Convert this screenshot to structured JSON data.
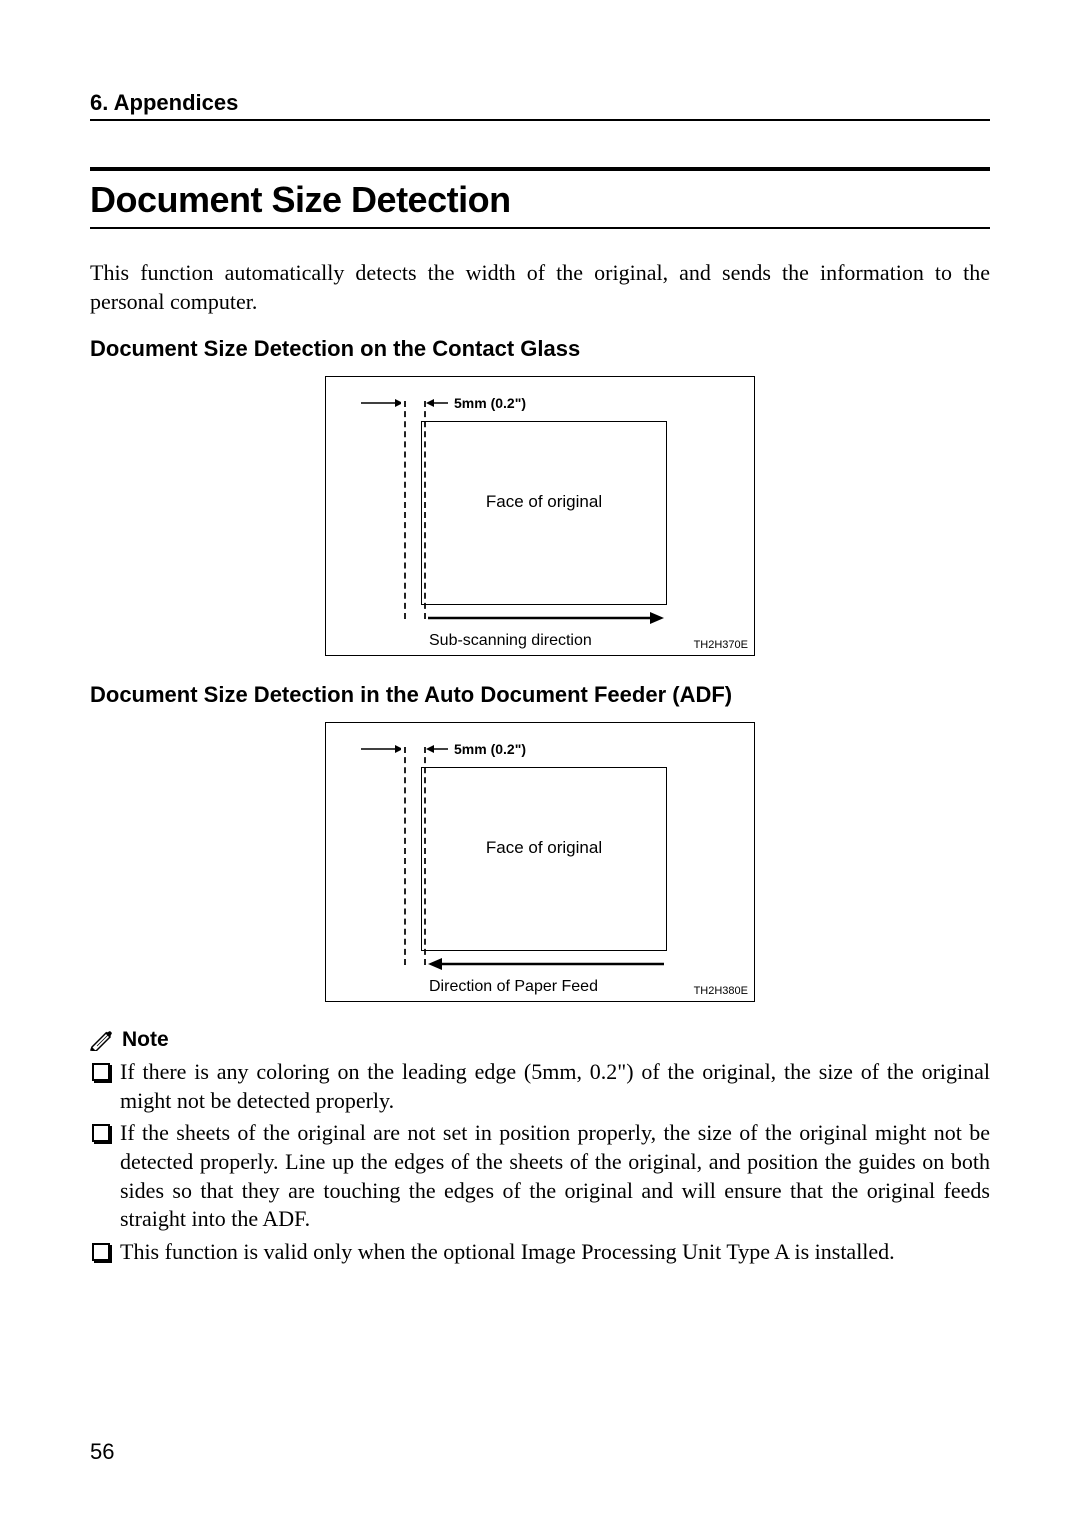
{
  "chapter": "6. Appendices",
  "section_title": "Document Size Detection",
  "intro": "This function automatically detects the width of the original, and sends the information to the personal computer.",
  "sub1": "Document Size Detection on the Contact Glass",
  "sub2": "Document Size Detection in the Auto Document Feeder (ADF)",
  "fig": {
    "mm": "5mm (0.2\")",
    "face": "Face of original",
    "bottom1": "Sub-scanning direction",
    "code1": "TH2H370E",
    "bottom2": "Direction of Paper Feed",
    "code2": "TH2H380E"
  },
  "note_label": "Note",
  "notes": [
    "If there is any coloring on the leading edge (5mm, 0.2\") of the original, the size of the original might not be detected properly.",
    "If the sheets of the original are not set in position properly, the size of the original might not be detected properly.  Line up the edges of the sheets of the original, and position the guides on both sides so that they are touching the edges of the original and will ensure that the original feeds straight into the ADF.",
    "This function is valid only when the optional Image Processing Unit Type A is installed."
  ],
  "page_number": "56"
}
